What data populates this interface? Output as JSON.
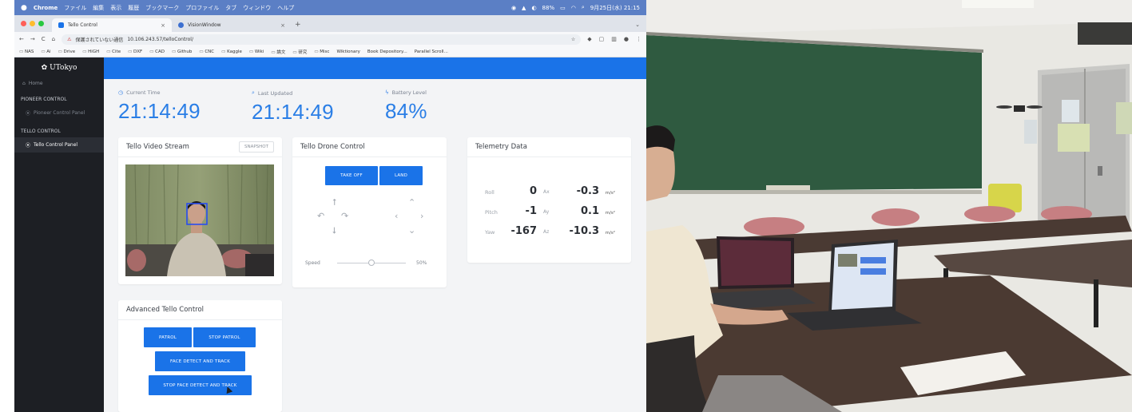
{
  "menubar": {
    "app": "Chrome",
    "items": [
      "ファイル",
      "編集",
      "表示",
      "履歴",
      "ブックマーク",
      "プロファイル",
      "タブ",
      "ウィンドウ",
      "ヘルプ"
    ],
    "battery": "88%",
    "datetime": "9月25日(水) 21:15"
  },
  "browser": {
    "tabs": [
      {
        "label": "Tello Control"
      },
      {
        "label": "VisionWindow"
      }
    ],
    "address": {
      "warning": "保護されていない通信",
      "url": "10.106.243.57/telloControl/"
    },
    "bookmarks": [
      "NAS",
      "Ai",
      "Drive",
      "HiGH",
      "Cite",
      "DXF",
      "CAD",
      "Github",
      "CNC",
      "Kaggle",
      "Wiki",
      "論文",
      "研究",
      "Misc",
      "Wiktionary",
      "Book Depository...",
      "Parallel Scroll..."
    ]
  },
  "sidebar": {
    "brand": "UTokyo",
    "home": "Home",
    "sections": [
      {
        "title": "PIONEER CONTROL",
        "items": [
          "Pioneer Control Panel"
        ]
      },
      {
        "title": "TELLO CONTROL",
        "items": [
          "Tello Control Panel"
        ]
      }
    ]
  },
  "stats": {
    "current_time_label": "Current Time",
    "current_time": "21:14:49",
    "last_updated_label": "Last Updated",
    "last_updated": "21:14:49",
    "battery_label": "Battery Level",
    "battery": "84%"
  },
  "video_card": {
    "title": "Tello Video Stream",
    "snapshot": "SNAPSHOT"
  },
  "control_card": {
    "title": "Tello Drone Control",
    "takeoff": "TAKE OFF",
    "land": "LAND",
    "speed_label": "Speed",
    "speed_value": "50%",
    "speed_fraction": 0.5
  },
  "telemetry": {
    "title": "Telemetry Data",
    "rows": [
      {
        "name": "Roll",
        "value": "0",
        "axis": "Ax",
        "accel": "-0.3",
        "unit": "m/s²"
      },
      {
        "name": "Pitch",
        "value": "-1",
        "axis": "Ay",
        "accel": "0.1",
        "unit": "m/s²"
      },
      {
        "name": "Yaw",
        "value": "-167",
        "axis": "Az",
        "accel": "-10.3",
        "unit": "m/s²"
      }
    ]
  },
  "advanced": {
    "title": "Advanced Tello Control",
    "patrol": "PATROL",
    "stop_patrol": "STOP PATROL",
    "face_track": "FACE DETECT AND TRACK",
    "stop_face_track": "STOP FACE DETECT AND TRACK"
  },
  "colors": {
    "accent": "#1a73e8",
    "sidebar": "#1d1f24",
    "board": "#2f5a40"
  }
}
